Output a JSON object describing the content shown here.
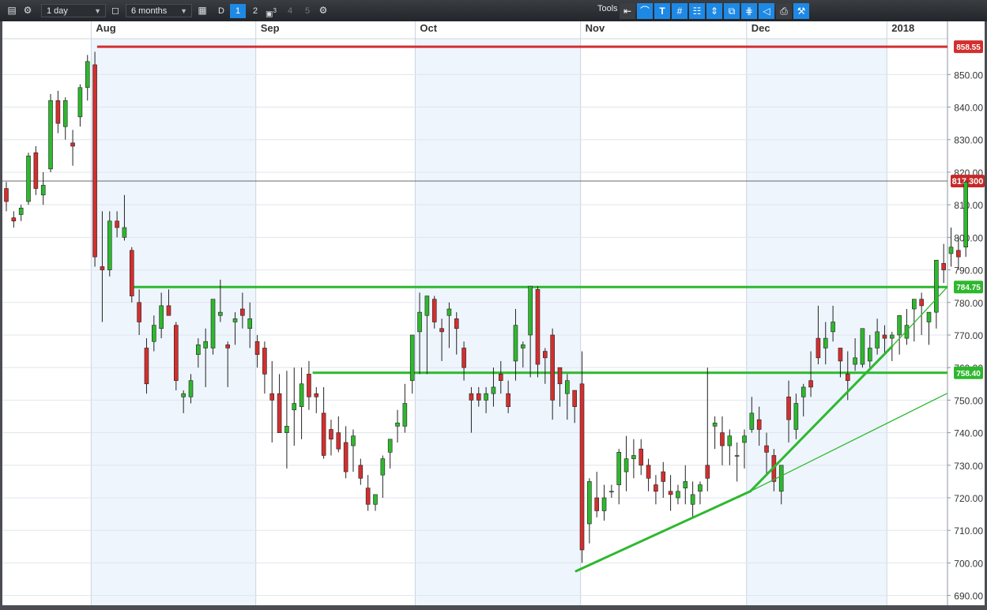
{
  "toolbar": {
    "interval": "1 day",
    "range": "6 months",
    "chart_type_letter": "D",
    "panes": [
      "1",
      "2",
      "3",
      "4",
      "5"
    ],
    "pane_superscript": "3",
    "tools_label": "Tools",
    "active_color": "#1e88e5"
  },
  "chart_data": {
    "type": "candlestick",
    "title": "",
    "xlabel": "",
    "ylabel": "",
    "ylim": [
      687,
      861
    ],
    "grid": true,
    "x_tick_labels": [
      "Aug",
      "Sep",
      "Oct",
      "Nov",
      "Dec",
      "2018"
    ],
    "y_ticks": [
      690,
      700,
      710,
      720,
      730,
      740,
      750,
      760,
      770,
      780,
      790,
      800,
      810,
      820,
      830,
      840,
      850
    ],
    "y_tick_labels": [
      "690.00",
      "700.00",
      "710.00",
      "720.00",
      "730.00",
      "740.00",
      "750.00",
      "760.00",
      "770.00",
      "780.00",
      "790.00",
      "800.00",
      "810.00",
      "820.00",
      "830.00",
      "840.00",
      "850.00"
    ],
    "current_price": 817.3,
    "current_price_label": "817.300",
    "horizontal_levels": [
      {
        "value": 858.55,
        "label": "858.55",
        "color": "#d32f2f"
      },
      {
        "value": 784.75,
        "label": "784.75",
        "color": "#2eb82e"
      },
      {
        "value": 758.4,
        "label": "758.40",
        "color": "#2eb82e"
      }
    ],
    "trendlines": [
      {
        "from": [
          "Nov 1",
          697.5
        ],
        "to": [
          "Dec 1",
          722
        ],
        "color": "#2eb82e",
        "weight": "thick"
      },
      {
        "from": [
          "Dec 1",
          722
        ],
        "to": [
          "Dec 27",
          766.5
        ],
        "color": "#2eb82e",
        "weight": "thick"
      },
      {
        "from": [
          "Dec 1",
          722
        ],
        "to": [
          "Jan 8",
          752
        ],
        "color": "#2eb82e",
        "weight": "thin"
      },
      {
        "from": [
          "Dec 27",
          766.5
        ],
        "to": [
          "Jan 8",
          784.5
        ],
        "color": "#2eb82e",
        "weight": "thin"
      }
    ],
    "up_color": "#2eb82e",
    "down_color": "#d32f2f",
    "candles": [
      [
        815,
        817,
        808,
        811
      ],
      [
        806,
        808,
        803,
        805
      ],
      [
        807,
        810,
        805,
        809
      ],
      [
        811,
        826,
        810,
        825
      ],
      [
        826,
        828,
        813,
        815
      ],
      [
        813,
        820,
        810,
        816
      ],
      [
        821,
        844,
        820,
        842
      ],
      [
        842,
        845,
        832,
        835
      ],
      [
        834,
        843,
        830,
        842
      ],
      [
        829,
        833,
        822,
        828
      ],
      [
        837,
        847,
        834,
        846
      ],
      [
        846,
        856,
        842,
        854
      ],
      [
        853,
        857,
        791,
        794
      ],
      [
        791,
        808,
        774,
        790
      ],
      [
        790,
        808,
        788,
        805
      ],
      [
        805,
        808,
        800,
        803
      ],
      [
        800,
        813,
        799,
        803
      ],
      [
        796,
        797,
        780,
        782
      ],
      [
        780,
        784,
        770,
        774
      ],
      [
        766,
        769,
        752,
        755
      ],
      [
        768,
        776,
        765,
        773
      ],
      [
        772,
        783,
        769,
        779
      ],
      [
        779,
        784,
        776,
        776
      ],
      [
        773,
        774,
        753,
        756
      ],
      [
        751,
        753,
        746,
        752
      ],
      [
        751,
        758,
        749,
        756
      ],
      [
        764,
        769,
        760,
        767
      ],
      [
        766,
        772,
        754,
        768
      ],
      [
        766,
        781,
        764,
        781
      ],
      [
        776,
        787,
        774,
        777
      ],
      [
        767,
        768,
        754,
        766
      ],
      [
        774,
        777,
        767,
        775
      ],
      [
        778,
        783,
        772,
        776
      ],
      [
        772,
        780,
        766,
        775
      ],
      [
        768,
        770,
        760,
        764
      ],
      [
        766,
        768,
        752,
        758
      ],
      [
        752,
        762,
        737,
        750
      ],
      [
        752,
        758,
        741,
        740
      ],
      [
        740,
        759,
        729,
        742
      ],
      [
        747,
        760,
        736,
        749
      ],
      [
        748,
        760,
        738,
        755
      ],
      [
        758,
        762,
        747,
        751
      ],
      [
        752,
        754,
        746,
        751
      ],
      [
        746,
        754,
        732,
        733
      ],
      [
        741,
        744,
        733,
        738
      ],
      [
        740,
        745,
        734,
        735
      ],
      [
        737,
        742,
        726,
        728
      ],
      [
        736,
        741,
        728,
        739
      ],
      [
        730,
        732,
        724,
        726
      ],
      [
        723,
        727,
        716,
        718
      ],
      [
        718,
        720,
        716,
        721
      ],
      [
        727,
        733,
        720,
        732
      ],
      [
        734,
        737,
        729,
        738
      ],
      [
        742,
        747,
        737,
        743
      ],
      [
        742,
        755,
        740,
        749
      ],
      [
        756,
        760,
        752,
        770
      ],
      [
        771,
        783,
        758,
        777
      ],
      [
        776,
        779,
        758,
        782
      ],
      [
        781,
        782,
        772,
        774
      ],
      [
        772,
        775,
        762,
        771
      ],
      [
        776,
        780,
        766,
        778
      ],
      [
        775,
        777,
        764,
        772
      ],
      [
        766,
        768,
        756,
        760
      ],
      [
        752,
        754,
        740,
        750
      ],
      [
        752,
        754,
        748,
        750
      ],
      [
        750,
        754,
        746,
        752
      ],
      [
        752,
        760,
        748,
        754
      ],
      [
        758,
        762,
        752,
        756
      ],
      [
        752,
        756,
        746,
        748
      ],
      [
        762,
        778,
        756,
        773
      ],
      [
        766,
        768,
        760,
        767
      ],
      [
        770,
        785,
        757,
        785
      ],
      [
        784,
        785,
        757,
        761
      ],
      [
        765,
        766,
        755,
        763
      ],
      [
        770,
        772,
        744,
        750
      ],
      [
        760,
        759,
        748,
        755
      ],
      [
        752,
        758,
        744,
        756
      ],
      [
        753,
        751,
        743,
        748
      ],
      [
        755,
        765,
        700,
        704
      ],
      [
        712,
        726,
        706,
        725
      ],
      [
        720,
        728,
        714,
        716
      ],
      [
        716,
        724,
        713,
        720
      ],
      [
        722,
        724,
        720,
        722
      ],
      [
        724,
        735,
        718,
        734
      ],
      [
        728,
        739,
        722,
        732
      ],
      [
        732,
        738,
        726,
        733
      ],
      [
        735,
        738,
        727,
        730
      ],
      [
        730,
        732,
        722,
        726
      ],
      [
        724,
        727,
        718,
        722
      ],
      [
        728,
        731,
        720,
        725
      ],
      [
        722,
        727,
        716,
        721
      ],
      [
        720,
        724,
        718,
        722
      ],
      [
        723,
        730,
        718,
        725
      ],
      [
        718,
        725,
        714,
        721
      ],
      [
        722,
        725,
        718,
        724
      ],
      [
        730,
        760,
        722,
        726
      ],
      [
        742,
        745,
        735,
        743
      ],
      [
        740,
        745,
        730,
        736
      ],
      [
        736,
        741,
        730,
        739
      ],
      [
        733,
        737,
        725,
        733
      ],
      [
        737,
        741,
        729,
        739
      ],
      [
        741,
        751,
        740,
        746
      ],
      [
        744,
        748,
        736,
        741
      ],
      [
        736,
        740,
        727,
        734
      ],
      [
        733,
        735,
        722,
        725
      ],
      [
        722,
        730,
        718,
        730
      ],
      [
        751,
        756,
        737,
        744
      ],
      [
        741,
        752,
        738,
        749
      ],
      [
        751,
        755,
        745,
        754
      ],
      [
        756,
        765,
        751,
        754
      ],
      [
        769,
        779,
        761,
        763
      ],
      [
        766,
        774,
        761,
        769
      ],
      [
        771,
        779,
        768,
        774
      ],
      [
        766,
        764,
        757,
        762
      ],
      [
        758,
        765,
        750,
        756
      ],
      [
        761,
        769,
        759,
        763
      ],
      [
        761,
        772,
        760,
        772
      ],
      [
        762,
        770,
        760,
        766
      ],
      [
        766,
        775,
        764,
        771
      ],
      [
        770,
        773,
        764,
        769
      ],
      [
        769,
        771,
        762,
        770
      ],
      [
        770,
        774,
        764,
        776
      ],
      [
        769,
        778,
        767,
        773
      ],
      [
        778,
        780,
        768,
        781
      ],
      [
        781,
        783,
        770,
        779
      ],
      [
        774,
        776,
        767,
        777
      ],
      [
        777,
        784,
        772,
        793
      ],
      [
        792,
        798,
        786,
        790
      ],
      [
        795,
        803,
        791,
        797
      ],
      [
        796,
        800,
        790,
        794
      ],
      [
        797,
        797,
        794,
        817
      ]
    ]
  }
}
